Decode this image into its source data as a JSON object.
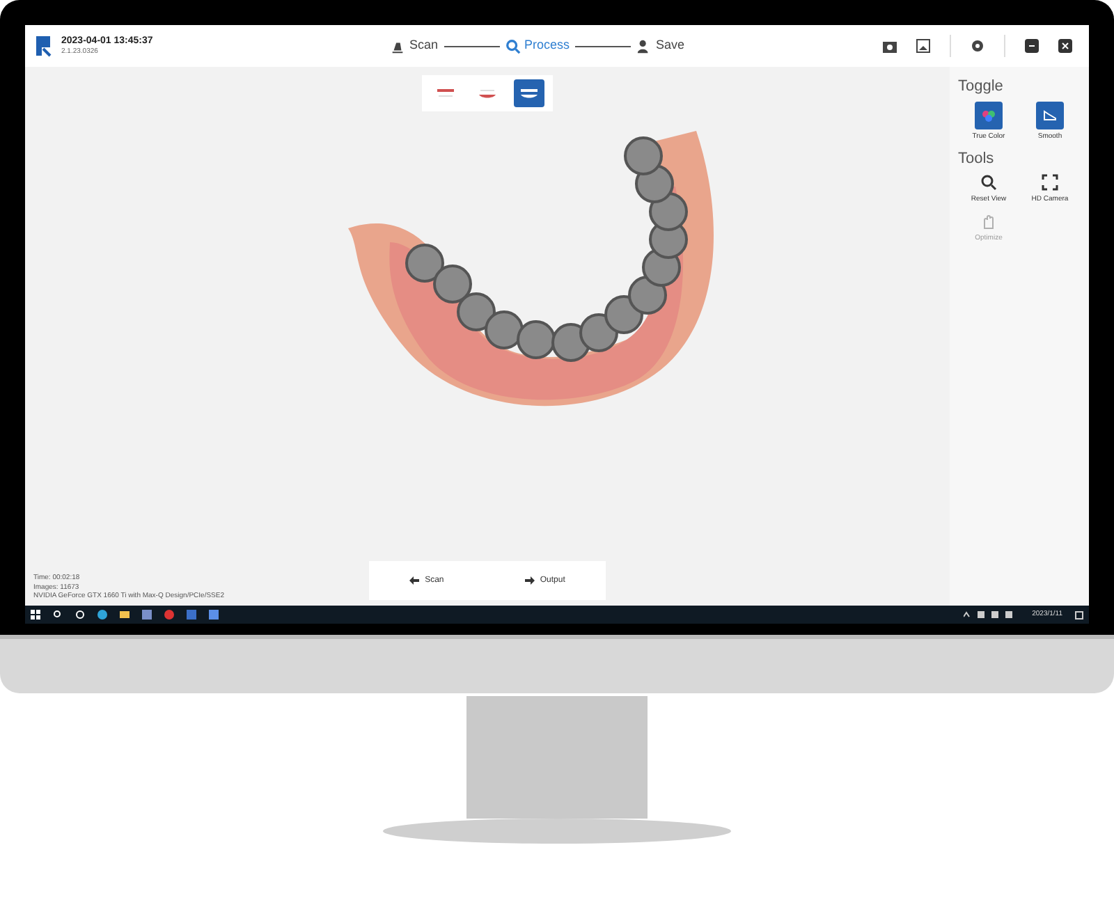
{
  "header": {
    "datetime": "2023-04-01 13:45:37",
    "version": "2.1.23.0326",
    "steps": [
      {
        "label": "Scan",
        "selected": false
      },
      {
        "label": "Process",
        "selected": true
      },
      {
        "label": "Save",
        "selected": false
      }
    ]
  },
  "view_modes": [
    {
      "kind": "upper",
      "selected": false
    },
    {
      "kind": "lower",
      "selected": false
    },
    {
      "kind": "both",
      "selected": true
    }
  ],
  "toggle": {
    "title": "Toggle",
    "items": [
      {
        "label": "True Color",
        "kind": "color",
        "on": true
      },
      {
        "label": "Smooth",
        "kind": "smooth",
        "on": true
      }
    ]
  },
  "tools": {
    "title": "Tools",
    "items": [
      {
        "label": "Reset View",
        "kind": "reset",
        "disabled": false
      },
      {
        "label": "HD Camera",
        "kind": "camera",
        "disabled": false
      },
      {
        "label": "Optimize",
        "kind": "optimize",
        "disabled": true
      }
    ]
  },
  "info": [
    "Time: 00:02:18",
    "Images: 11673",
    "NVIDIA GeForce GTX 1660 Ti with Max-Q Design/PCIe/SSE2"
  ],
  "nav": [
    {
      "label": "Scan",
      "kind": "back"
    },
    {
      "label": "Output",
      "kind": "forward"
    }
  ],
  "taskbar": {
    "date": "2023/1/11"
  }
}
